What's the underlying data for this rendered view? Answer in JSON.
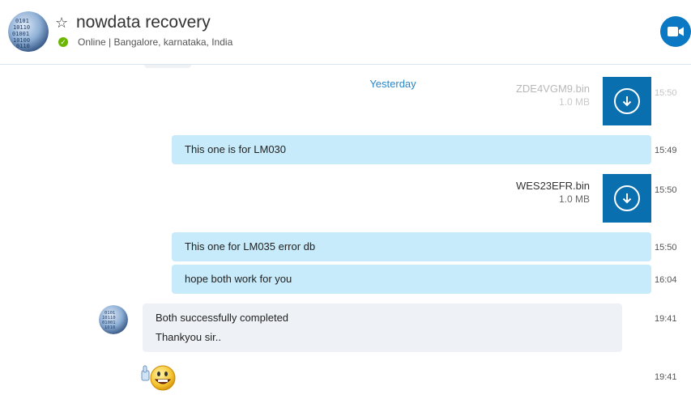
{
  "header": {
    "title": "nowdata recovery",
    "status": "Online | Bangalore, karnataka, India",
    "status_icon": "check-icon",
    "favorite_icon": "star-outline-icon",
    "video_icon": "video-camera-icon",
    "accent": "#0a78c2"
  },
  "chat": {
    "date_separator": "Yesterday",
    "files": [
      {
        "name": "ZDE4VGM9.bin",
        "size": "1.0 MB",
        "time": "15:50"
      },
      {
        "name": "WES23EFR.bin",
        "size": "1.0 MB",
        "time": "15:50"
      }
    ],
    "outgoing": [
      {
        "text": "This one is for LM030",
        "time": "15:49"
      },
      {
        "text": "This one for LM035 error db",
        "time": "15:50"
      },
      {
        "text": "hope both work for you",
        "time": "16:04"
      }
    ],
    "incoming": {
      "lines": [
        "Both successfully completed",
        "Thankyou sir.."
      ],
      "time": "19:41"
    },
    "emoticon": {
      "name": "thumbs-up-smile-emoticon",
      "time": "19:41"
    }
  },
  "colors": {
    "outgoing_bubble": "#c7ebfa",
    "incoming_bubble": "#eef1f5",
    "download_tile": "#0a6fae",
    "online": "#6bb700"
  }
}
